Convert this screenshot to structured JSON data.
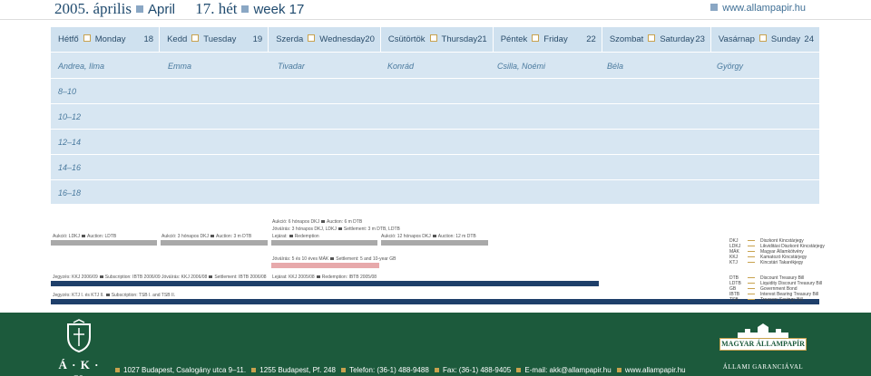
{
  "header": {
    "year_month": "2005. április",
    "month_en": "April",
    "week_hu": "17. hét",
    "week_en": "week 17",
    "url": "www.allampapir.hu"
  },
  "days": [
    {
      "hu": "Hétfő",
      "en": "Monday",
      "num": "18"
    },
    {
      "hu": "Kedd",
      "en": "Tuesday",
      "num": "19"
    },
    {
      "hu": "Szerda",
      "en": "Wednesday",
      "num": "20"
    },
    {
      "hu": "Csütörtök",
      "en": "Thursday",
      "num": "21"
    },
    {
      "hu": "Péntek",
      "en": "Friday",
      "num": "22"
    },
    {
      "hu": "Szombat",
      "en": "Saturday",
      "num": "23"
    },
    {
      "hu": "Vasárnap",
      "en": "Sunday",
      "num": "24"
    }
  ],
  "namedays": [
    "Andrea, Ilma",
    "Emma",
    "Tivadar",
    "Konrád",
    "Csilla, Noémi",
    "Béla",
    "György"
  ],
  "times": [
    "8–10",
    "10–12",
    "12–14",
    "14–16",
    "16–18"
  ],
  "events": {
    "wed_auction_6m": "Aukció: 6 hónapos DKJ",
    "wed_auction_6m_en": "Auction: 6 m DTB",
    "wed_settle": "Jóváírás: 3 hónapos DKJ, LDKJ",
    "wed_settle_en": "Settlement: 3 m DTB, LDTB",
    "wed_lejarat": "Lejárat:",
    "wed_lejarat_en": "Redemption",
    "mon_auction": "Aukció: LDKJ",
    "mon_auction_en": "Auction: LDTB",
    "tue_auction": "Aukció: 3 hónapos DKJ",
    "tue_auction_en": "Auction: 3 m DTB",
    "thu_auction": "Aukció: 12 hónapos DKJ",
    "thu_auction_en": "Auction: 12 m DTB",
    "wed_settle_bonds": "Jóváírás: 5 és 10 éves MÁK",
    "wed_settle_bonds_en": "Settlement: 5 and 10-year GB",
    "mon_jegyzes": "Jegyzés: KKJ 2006/09",
    "mon_jegyzes_en": "Subscription: IBTB 2006/09",
    "tue_jovairas": "Jóváírás: KKJ 2006/08",
    "tue_jovairas_en": "Settlement: IBTB 2006/08",
    "wed_lejarat2": "Lejárat: KKJ 2005/08",
    "wed_lejarat2_en": "Redemption: IBTB 2005/08",
    "mon_jegyzes2": "Jegyzés: KTJ I. és KTJ II.",
    "mon_jegyzes2_en": "Subscription: TSB I. and TSB II."
  },
  "legend": [
    {
      "abbr": "DKJ",
      "text": "Diszkont Kincstárjegy"
    },
    {
      "abbr": "LDKJ",
      "text": "Likviditási Diszkont Kincstárjegy"
    },
    {
      "abbr": "MÁK",
      "text": "Magyar Államkötvény"
    },
    {
      "abbr": "KKJ",
      "text": "Kamatozó Kincstárjegy"
    },
    {
      "abbr": "KTJ",
      "text": "Kincstári Takarékjegy"
    },
    {
      "abbr": "DTB",
      "text": "Discount Treasury Bill"
    },
    {
      "abbr": "LDTB",
      "text": "Liquidity Discount Treasury Bill"
    },
    {
      "abbr": "GB",
      "text": "Government Bond"
    },
    {
      "abbr": "IBTB",
      "text": "Interest Bearing Treasury Bill"
    },
    {
      "abbr": "TSB",
      "text": "Treasury Savings Bill"
    }
  ],
  "footer": {
    "address": "1027 Budapest, Csalogány utca 9–11.",
    "pobox": "1255 Budapest, Pf. 248",
    "phone": "Telefon: (36-1) 488-9488",
    "fax": "Fax: (36-1) 488-9405",
    "email": "E-mail: akk@allampapir.hu",
    "web": "www.allampapir.hu",
    "logo_left": "Á · K · K",
    "logo_right_banner": "MAGYAR ÁLLAMPAPÍR",
    "logo_right_sub": "ÁLLAMI GARANCIÁVAL"
  },
  "colors": {
    "accent": "#c8a24e",
    "calendar_bg": "#d7e6f2",
    "footer_bg": "#1c5a3c",
    "bar_gray": "#a9a9a9",
    "bar_pink": "#e7a9ab",
    "bar_navy": "#1e3f6a"
  }
}
